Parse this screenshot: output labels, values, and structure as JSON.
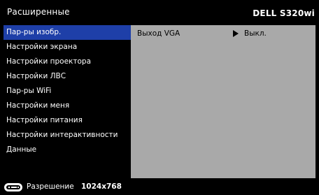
{
  "header": {
    "title": "Расширенные",
    "brand": "DELL S320wi"
  },
  "sidebar": {
    "items": [
      {
        "label": "Пар-ры изобр.",
        "selected": true
      },
      {
        "label": "Настройки экрана",
        "selected": false
      },
      {
        "label": "Настройки проектора",
        "selected": false
      },
      {
        "label": "Настройки ЛВС",
        "selected": false
      },
      {
        "label": "Пар-ры WiFi",
        "selected": false
      },
      {
        "label": "Настройки меня",
        "selected": false
      },
      {
        "label": "Настройки питания",
        "selected": false
      },
      {
        "label": "Настройки интерактивности",
        "selected": false
      },
      {
        "label": "Данные",
        "selected": false
      }
    ]
  },
  "content": {
    "settings": [
      {
        "label": "Выход VGA",
        "value": "Выкл."
      }
    ]
  },
  "status": {
    "icon": "remote-control-icon",
    "label": "Разрешение",
    "value": "1024x768"
  },
  "colors": {
    "background": "#000000",
    "selected": "#1e3fa8",
    "panel": "#a9a9a9"
  }
}
